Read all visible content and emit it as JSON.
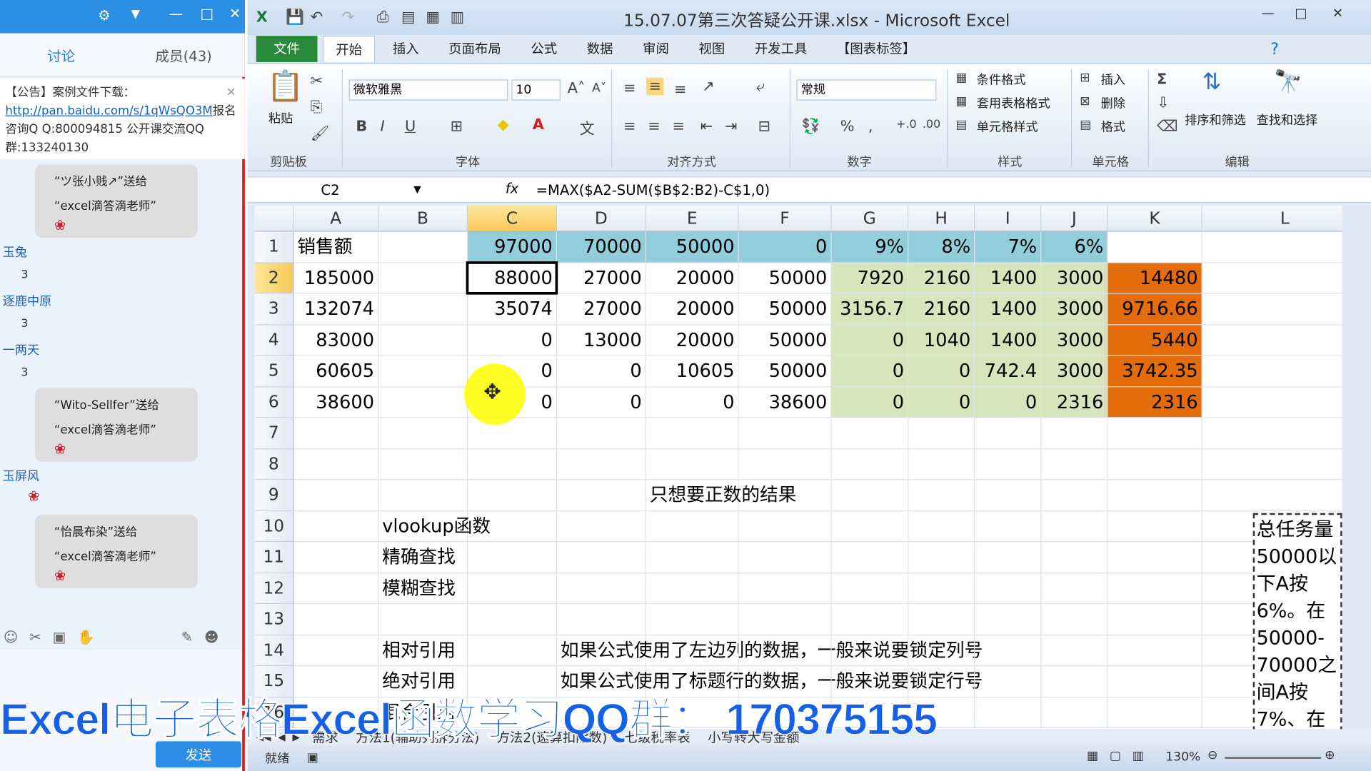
{
  "chat": {
    "tabs": [
      "讨论",
      "成员(43)"
    ],
    "notice_prefix": "【公告】案例文件下载：",
    "notice_link": "http://pan.baidu.com/s/1qWsQO3M",
    "notice_rest": "报名咨询Q Q:800094815  公开课交流QQ群:133240130",
    "messages": [
      {
        "sender": "“ツ张小贱↗”送给",
        "to": "“excel滴答滴老师”"
      },
      {
        "sender": "“Wito-Sellfer”送给",
        "to": "“excel滴答滴老师”"
      },
      {
        "sender": "“怡晨布染”送给",
        "to": "“excel滴答滴老师”"
      }
    ],
    "users": [
      {
        "name": "玉兔",
        "value": "3"
      },
      {
        "name": "逐鹿中原",
        "value": "3"
      },
      {
        "name": "一两天",
        "value": "3"
      },
      {
        "name": "玉屏风",
        "value": ""
      }
    ],
    "send_label": "发送"
  },
  "excel": {
    "window_title": "15.07.07第三次答疑公开课.xlsx - Microsoft Excel",
    "ribbon_tabs": [
      "文件",
      "开始",
      "插入",
      "页面布局",
      "公式",
      "数据",
      "审阅",
      "视图",
      "开发工具",
      "【图表标签】"
    ],
    "active_tab": "开始",
    "font_name": "微软雅黑",
    "font_size": "10",
    "number_format": "常规",
    "groups": [
      "剪贴板",
      "字体",
      "对齐方式",
      "数字",
      "样式",
      "单元格",
      "编辑"
    ],
    "style_buttons": [
      "条件格式",
      "套用表格格式",
      "单元格样式"
    ],
    "cell_buttons": [
      "插入",
      "删除",
      "格式"
    ],
    "edit_buttons": [
      "排序和筛选",
      "查找和选择"
    ],
    "paste_label": "粘贴",
    "name_box": "C2",
    "formula": "=MAX($A2-SUM($B$2:B2)-C$1,0)",
    "columns": [
      "A",
      "B",
      "C",
      "D",
      "E",
      "F",
      "G",
      "H",
      "I",
      "J",
      "K",
      "L"
    ],
    "rows": [
      [
        "销售额",
        "",
        "97000",
        "70000",
        "50000",
        "0",
        "9%",
        "8%",
        "7%",
        "6%",
        "",
        ""
      ],
      [
        "185000",
        "",
        "88000",
        "27000",
        "20000",
        "50000",
        "7920",
        "2160",
        "1400",
        "3000",
        "14480",
        ""
      ],
      [
        "132074",
        "",
        "35074",
        "27000",
        "20000",
        "50000",
        "3156.7",
        "2160",
        "1400",
        "3000",
        "9716.66",
        ""
      ],
      [
        "83000",
        "",
        "0",
        "13000",
        "20000",
        "50000",
        "0",
        "1040",
        "1400",
        "3000",
        "5440",
        ""
      ],
      [
        "60605",
        "",
        "0",
        "0",
        "10605",
        "50000",
        "0",
        "0",
        "742.4",
        "3000",
        "3742.35",
        ""
      ],
      [
        "38600",
        "",
        "0",
        "0",
        "0",
        "38600",
        "0",
        "0",
        "0",
        "2316",
        "2316",
        ""
      ]
    ],
    "note_row9": "只想要正数的结果",
    "text_rows": [
      {
        "row": "10",
        "b": "vlookup函数",
        "d": ""
      },
      {
        "row": "11",
        "b": "精确查找",
        "d": ""
      },
      {
        "row": "12",
        "b": "模糊查找",
        "d": ""
      },
      {
        "row": "13",
        "b": "",
        "d": ""
      },
      {
        "row": "14",
        "b": "相对引用",
        "d": "如果公式使用了左边列的数据，一般来说要锁定列号"
      },
      {
        "row": "15",
        "b": "绝对引用",
        "d": "如果公式使用了标题行的数据，一般来说要锁定行号"
      },
      {
        "row": "16",
        "b": "混合引用",
        "d": ""
      }
    ],
    "side_note": "总任务量50000以下A按6%。在50000-70000之间A按7%、在",
    "sheet_tabs": [
      "需求",
      "方法1(辅助列拆分法)",
      "方法2(速算扣除数)",
      "七级税率表",
      "小写转大写金额"
    ],
    "status": "就绪",
    "zoom": "130%"
  },
  "overlay_text": "Excel电子表格Excel函数学习QQ群： 170375155"
}
